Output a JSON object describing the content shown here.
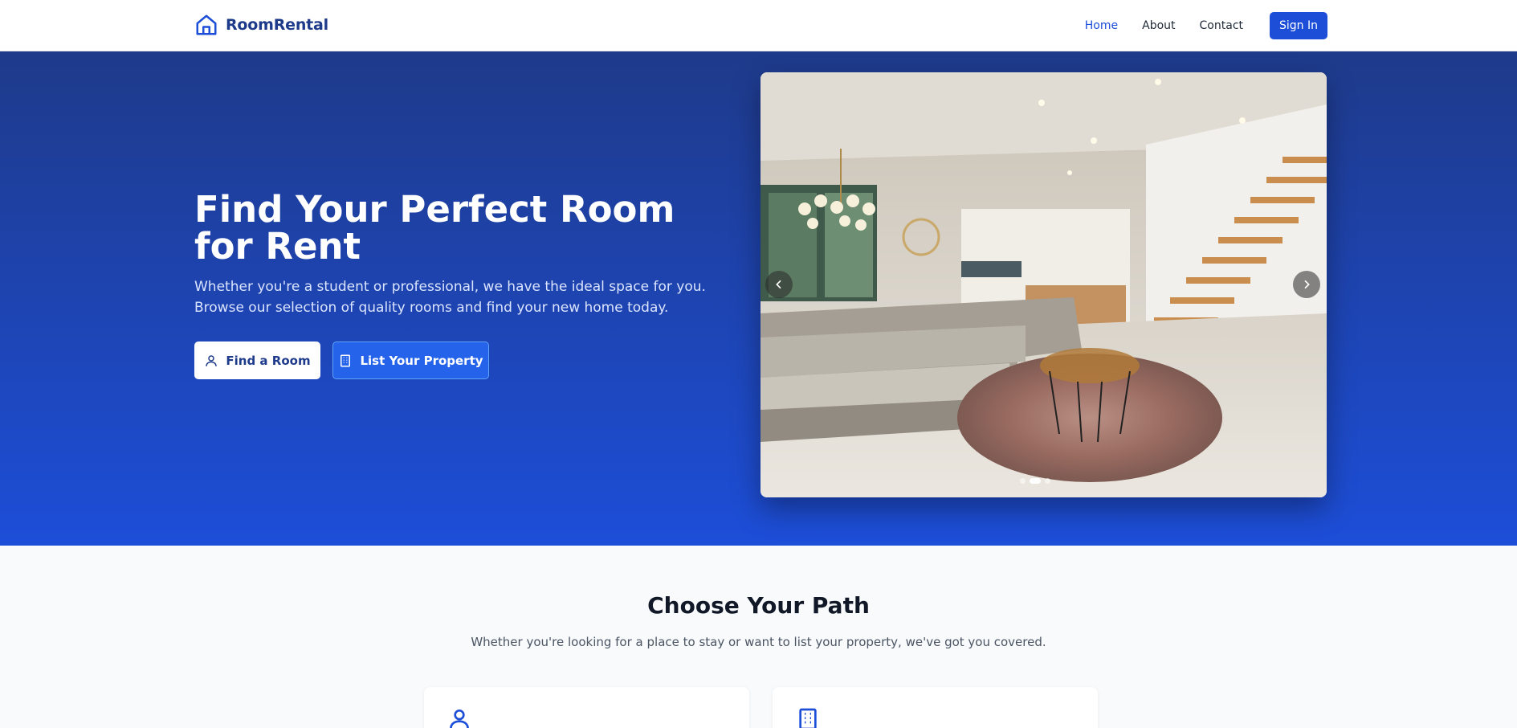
{
  "header": {
    "brand": "RoomRental",
    "nav": [
      {
        "label": "Home",
        "active": true
      },
      {
        "label": "About",
        "active": false
      },
      {
        "label": "Contact",
        "active": false
      }
    ],
    "signin_label": "Sign In"
  },
  "hero": {
    "title": "Find Your Perfect Room for Rent",
    "subtitle": "Whether you're a student or professional, we have the ideal space for you. Browse our selection of quality rooms and find your new home today.",
    "primary_button": "Find a Room",
    "secondary_button": "List Your Property",
    "carousel": {
      "slide_count": 3,
      "active_slide": 2
    }
  },
  "section": {
    "title": "Choose Your Path",
    "subtitle": "Whether you're looking for a place to stay or want to list your property, we've got you covered."
  },
  "colors": {
    "brand": "#1e3a8a",
    "accent": "#1d4ed8",
    "hero_gradient_top": "#1e3a8a",
    "hero_gradient_bottom": "#1d4ed8",
    "page_background": "#f8fafc"
  },
  "icons": {
    "logo": "house-icon",
    "find_room": "user-icon",
    "list_property": "building-icon",
    "prev": "chevron-left-icon",
    "next": "chevron-right-icon"
  }
}
